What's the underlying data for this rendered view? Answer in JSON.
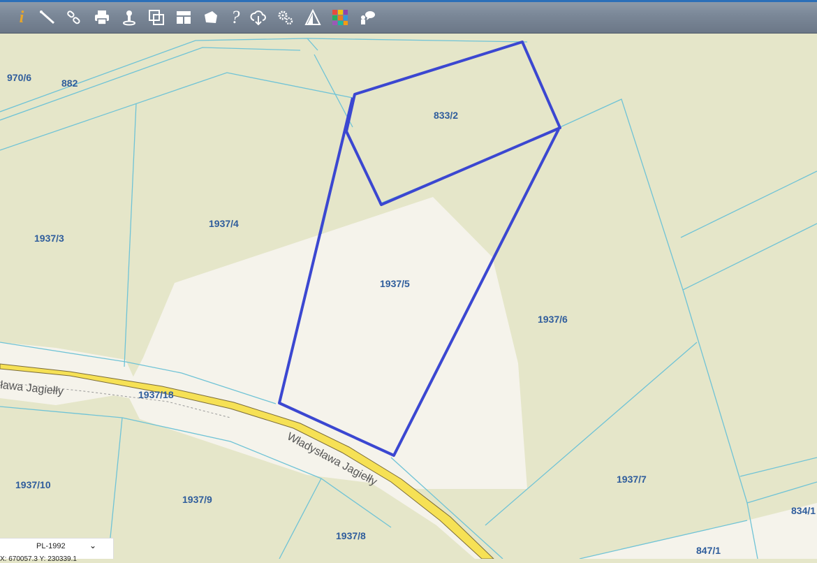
{
  "toolbar": {
    "icons": [
      {
        "name": "info-icon",
        "glyph": "i"
      },
      {
        "name": "measure-line-icon"
      },
      {
        "name": "link-icon"
      },
      {
        "name": "print-icon"
      },
      {
        "name": "locate-pin-icon"
      },
      {
        "name": "copy-window-icon"
      },
      {
        "name": "layout-icon"
      },
      {
        "name": "area-shape-icon"
      },
      {
        "name": "help-icon",
        "glyph": "?"
      },
      {
        "name": "cloud-download-icon"
      },
      {
        "name": "settings-icon"
      },
      {
        "name": "sun-warning-icon"
      },
      {
        "name": "color-grid-icon"
      },
      {
        "name": "chat-user-icon"
      }
    ]
  },
  "map": {
    "parcels": {
      "p970_6": "970/6",
      "p882": "882",
      "p833_2": "833/2",
      "p1937_3": "1937/3",
      "p1937_4": "1937/4",
      "p1937_5": "1937/5",
      "p1937_6": "1937/6",
      "p1937_18": "1937/18",
      "p1937_10": "1937/10",
      "p1937_9": "1937/9",
      "p1937_8": "1937/8",
      "p1937_7": "1937/7",
      "p834_1": "834/1",
      "p847_1": "847/1"
    },
    "streets": {
      "west": "ława Jagiełły",
      "main": "Władysława Jagiełły"
    },
    "colors": {
      "background": "#e5e6c9",
      "cleared_area": "#f5f3eb",
      "parcel_lines": "#6fc3d6",
      "highlight": "#3b47d1",
      "road": "#f6e155"
    }
  },
  "crs": {
    "selected": "PL-1992",
    "coords": "X: 670057.3   Y: 230339.1"
  }
}
